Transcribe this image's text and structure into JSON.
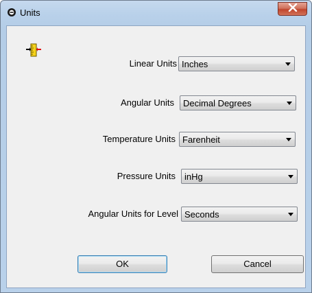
{
  "window": {
    "title": "Units",
    "close_glyph": "x"
  },
  "icons": {
    "app": "settings-app-icon",
    "units": "ruler-units-icon",
    "close": "close-icon",
    "dropdown": "chevron-down-icon"
  },
  "fields": [
    {
      "label": "Linear Units",
      "value": "Inches"
    },
    {
      "label": "Angular Units",
      "value": "Decimal Degrees"
    },
    {
      "label": "Temperature Units",
      "value": "Farenheit"
    },
    {
      "label": "Pressure Units",
      "value": "inHg"
    },
    {
      "label": "Angular Units for Level",
      "value": "Seconds"
    }
  ],
  "buttons": {
    "ok_label": "OK",
    "cancel_label": "Cancel"
  },
  "colors": {
    "frame": "#b9d1ea",
    "client": "#f0f0f0",
    "close_button": "#c0452d"
  }
}
